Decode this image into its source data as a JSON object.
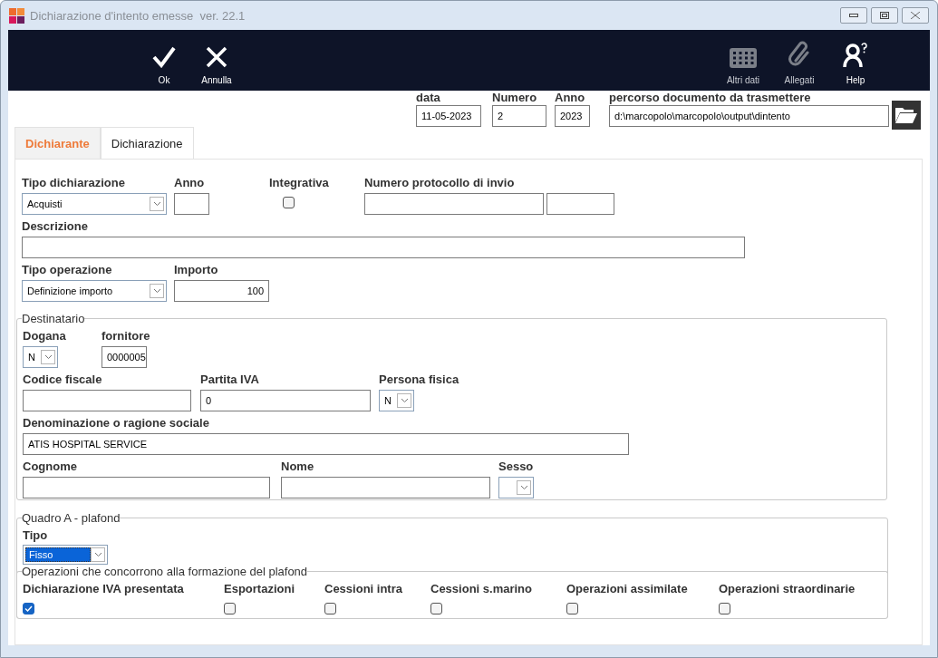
{
  "window": {
    "title": "Dichiarazione d'intento emesse  ver. 22.1"
  },
  "toolbar": {
    "left": [
      {
        "kind": "ok",
        "label": "Ok",
        "disabled": false
      },
      {
        "kind": "cancel",
        "label": "Annulla",
        "disabled": false
      }
    ],
    "right": [
      {
        "kind": "grid",
        "label": "Altri dati",
        "disabled": true
      },
      {
        "kind": "attach",
        "label": "Allegati",
        "disabled": true
      },
      {
        "kind": "help",
        "label": "Help",
        "disabled": false
      }
    ]
  },
  "header": {
    "fields": [
      {
        "label": "data",
        "value": "11-05-2023"
      },
      {
        "label": "Numero",
        "value": "2"
      },
      {
        "label": "Anno",
        "value": "2023"
      },
      {
        "label": "percorso documento da trasmettere",
        "value": "d:\\marcopolo\\marcopolo\\output\\dintento"
      }
    ]
  },
  "tabs": [
    {
      "label": "Dichiarante",
      "selected": false
    },
    {
      "label": "Dichiarazione",
      "selected": true
    }
  ],
  "form": {
    "rows": [
      [
        {
          "kind": "select",
          "label": "Tipo dichiarazione",
          "value": "Acquisti"
        },
        {
          "kind": "text",
          "label": "Anno"
        },
        {
          "kind": "checkbox",
          "label": "Integrativa",
          "checked": false
        },
        {
          "kind": "split-text",
          "label": "Numero protocollo di invio"
        }
      ],
      [
        {
          "kind": "text",
          "label": "Descrizione"
        }
      ],
      [
        {
          "kind": "select",
          "label": "Tipo operazione",
          "value": "Definizione importo"
        },
        {
          "kind": "number",
          "label": "Importo",
          "value": "100"
        }
      ]
    ]
  },
  "destinatario": {
    "legend": "Destinatario",
    "rows": [
      [
        {
          "kind": "select",
          "label": "Dogana",
          "value": "N"
        },
        {
          "kind": "text",
          "label": "fornitore",
          "value": "0000005"
        }
      ],
      [
        {
          "kind": "text",
          "label": "Codice fiscale"
        },
        {
          "kind": "text",
          "label": "Partita IVA",
          "value": "0"
        },
        {
          "kind": "select",
          "label": "Persona fisica",
          "value": "N"
        }
      ],
      [
        {
          "kind": "text",
          "label": "Denominazione o ragione sociale",
          "value": "ATIS HOSPITAL SERVICE"
        }
      ],
      [
        {
          "kind": "text",
          "label": "Cognome"
        },
        {
          "kind": "text",
          "label": "Nome"
        },
        {
          "kind": "select",
          "label": "Sesso"
        }
      ]
    ]
  },
  "quadro_a": {
    "legend": "Quadro A - plafond",
    "rows": [
      [
        {
          "kind": "select",
          "label": "Tipo",
          "value": "Fisso",
          "highlighted": true
        }
      ]
    ],
    "operazioni": {
      "legend": "Operazioni che concorrono alla formazione del plafond",
      "items": [
        {
          "label": "Dichiarazione IVA presentata",
          "checked": true
        },
        {
          "label": "Esportazioni",
          "checked": false
        },
        {
          "label": "Cessioni intra",
          "checked": false
        },
        {
          "label": "Cessioni s.marino",
          "checked": false
        },
        {
          "label": "Operazioni assimilate",
          "checked": false
        },
        {
          "label": "Operazioni straordinarie",
          "checked": false
        }
      ]
    }
  }
}
